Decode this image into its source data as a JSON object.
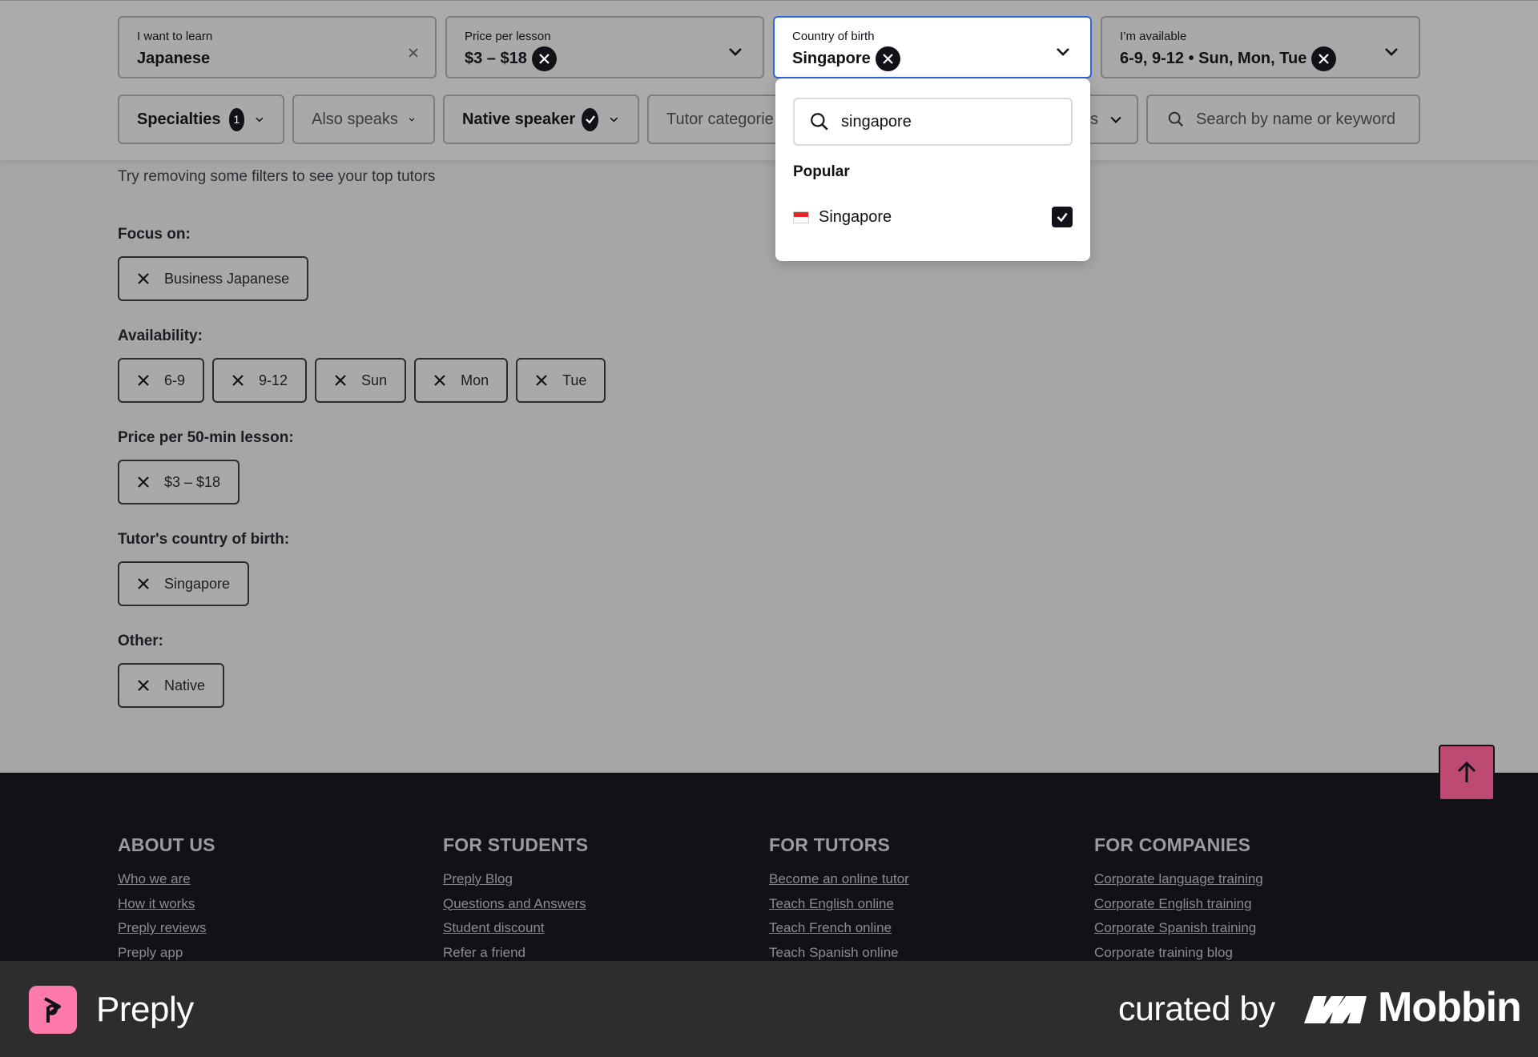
{
  "filters": {
    "learn": {
      "label": "I want to learn",
      "value": "Japanese"
    },
    "price": {
      "label": "Price per lesson",
      "value": "$3 – $18"
    },
    "country": {
      "label": "Country of birth",
      "value": "Singapore"
    },
    "availability": {
      "label": "I’m available",
      "value": "6-9, 9-12 • Sun, Mon, Tue"
    }
  },
  "chips": {
    "specialties": {
      "label": "Specialties",
      "count": "1"
    },
    "also_speaks": {
      "label": "Also speaks"
    },
    "native_speaker": {
      "label": "Native speaker"
    },
    "tutor_categories": {
      "label": "Tutor categorie"
    },
    "hidden_chip_tail": {
      "label": "s"
    },
    "search": {
      "placeholder": "Search by name or keyword"
    }
  },
  "dropdown": {
    "search_value": "singapore",
    "section": "Popular",
    "items": [
      {
        "name": "Singapore",
        "checked": true
      }
    ]
  },
  "main": {
    "hint": "Try removing some filters to see your top tutors",
    "groups": [
      {
        "title": "Focus on:",
        "tags": [
          "Business Japanese"
        ]
      },
      {
        "title": "Availability:",
        "tags": [
          "6-9",
          "9-12",
          "Sun",
          "Mon",
          "Tue"
        ]
      },
      {
        "title": "Price per 50-min lesson:",
        "tags": [
          "$3 – $18"
        ]
      },
      {
        "title": "Tutor's country of birth:",
        "tags": [
          "Singapore"
        ]
      },
      {
        "title": "Other:",
        "tags": [
          "Native"
        ]
      }
    ]
  },
  "footer": {
    "about": {
      "title": "ABOUT US",
      "links": [
        "Who we are",
        "How it works",
        "Preply reviews",
        "Preply app"
      ]
    },
    "students": {
      "title": "FOR STUDENTS",
      "links": [
        "Preply Blog",
        "Questions and Answers",
        "Student discount",
        "Refer a friend"
      ]
    },
    "tutors": {
      "title": "FOR TUTORS",
      "links": [
        "Become an online tutor",
        "Teach English online",
        "Teach French online",
        "Teach Spanish online"
      ]
    },
    "companies": {
      "title": "FOR COMPANIES",
      "links": [
        "Corporate language training",
        "Corporate English training",
        "Corporate Spanish training",
        "Corporate training blog"
      ]
    }
  },
  "branding": {
    "app_name": "Preply",
    "curated_by": "curated by",
    "curator": "Mobbin"
  },
  "colors": {
    "accent_blue": "#2f65d4",
    "brand_pink": "#ff7aac",
    "scroll_top": "#bd4a73",
    "footer_bg": "#121117"
  }
}
